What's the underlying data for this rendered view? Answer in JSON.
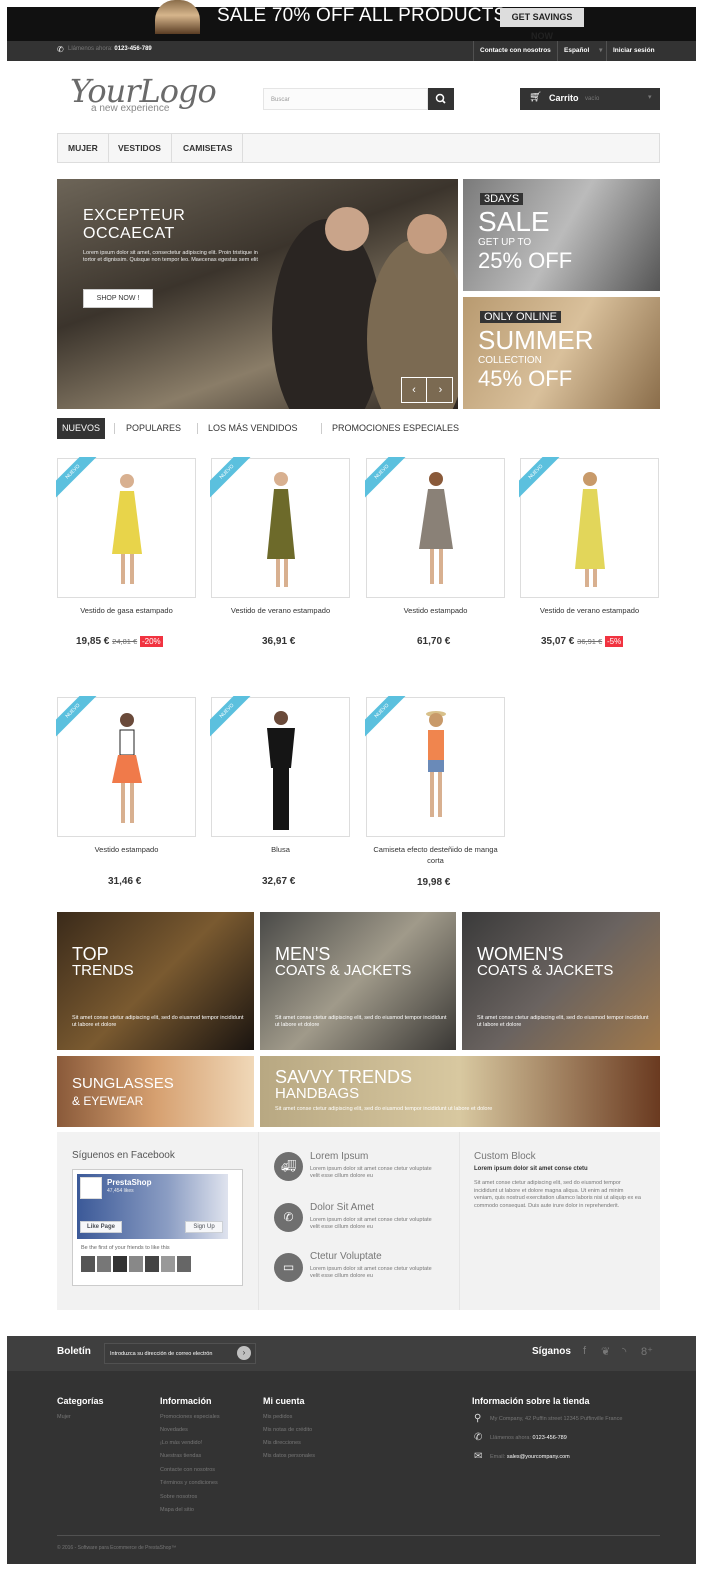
{
  "top_banner": {
    "text": "SALE 70% OFF ALL PRODUCTS",
    "button": "GET SAVINGS NOW"
  },
  "nav": {
    "phone_label": "Llámenos ahora:",
    "phone": "0123-456-789",
    "contact": "Contacte con nosotros",
    "language": "Español",
    "login": "Iniciar sesión"
  },
  "header": {
    "logo": "YourLogo",
    "logo_sub": "a new experience",
    "search_placeholder": "Buscar",
    "cart_label": "Carrito",
    "cart_status": "vacío"
  },
  "menu": [
    "MUJER",
    "VESTIDOS",
    "CAMISETAS"
  ],
  "slider": {
    "title1": "EXCEPTEUR",
    "title2": "OCCAECAT",
    "text": "Lorem ipsum dolor sit amet, consectetur adipiscing elit. Proin tristique in tortor et dignissim. Quisque non tempor leo. Maecenas egestas sem elit",
    "button": "SHOP NOW !"
  },
  "promo1": {
    "tag": "3DAYS",
    "big": "SALE",
    "small": "GET UP TO",
    "value": "25% OFF"
  },
  "promo2": {
    "tag": "ONLY ONLINE",
    "big": "SUMMER",
    "small": "COLLECTION",
    "value": "45% OFF"
  },
  "tabs": [
    "NUEVOS",
    "POPULARES",
    "LOS MÁS VENDIDOS",
    "PROMOCIONES ESPECIALES"
  ],
  "ribbon": "NUEVO",
  "products": [
    {
      "name": "Vestido de gasa estampado",
      "price": "19,85 €",
      "old": "24,81 €",
      "discount": "-20%",
      "dress": "#e8d44a"
    },
    {
      "name": "Vestido de verano estampado",
      "price": "36,91 €",
      "old": "",
      "discount": "",
      "dress": "#6d6a2a"
    },
    {
      "name": "Vestido estampado",
      "price": "61,70 €",
      "old": "",
      "discount": "",
      "dress": "#8a8177"
    },
    {
      "name": "Vestido de verano estampado",
      "price": "35,07 €",
      "old": "36,91 €",
      "discount": "-5%",
      "dress": "#e2d65a"
    },
    {
      "name": "Vestido estampado",
      "price": "31,46 €",
      "old": "",
      "discount": "",
      "dress": "#f07a4a"
    },
    {
      "name": "Blusa",
      "price": "32,67 €",
      "old": "",
      "discount": "",
      "dress": "#151515"
    },
    {
      "name": "Camiseta efecto desteñido de manga corta",
      "price": "19,98 €",
      "old": "",
      "discount": "",
      "dress": "#f0854e"
    }
  ],
  "tiles": {
    "top_trends": {
      "big": "TOP",
      "small": "TRENDS",
      "text": "Sit amet conse ctetur adipiscing elit, sed do eiusmod tempor incididunt ut labore et dolore"
    },
    "mens": {
      "big": "MEN'S",
      "small": "COATS & JACKETS",
      "text": "Sit amet conse ctetur adipiscing elit, sed do eiusmod tempor incididunt ut labore et dolore"
    },
    "womens": {
      "big": "WOMEN'S",
      "small": "COATS & JACKETS",
      "text": "Sit amet conse ctetur adipiscing elit, sed do eiusmod tempor incididunt ut labore et dolore"
    },
    "sunglasses": {
      "big": "SUNGLASSES",
      "small": "& EYEWEAR"
    },
    "savvy": {
      "big": "SAVVY TRENDS",
      "small": "HANDBAGS",
      "text": "Sit amet conse ctetur adipiscing elit, sed do eiusmod tempor incididunt ut labore et dolore"
    }
  },
  "facebook": {
    "title": "Síguenos en Facebook",
    "page_name": "PrestaShop",
    "likes": "47,454 likes",
    "like_button": "Like Page",
    "signup_button": "Sign Up",
    "friends_text": "Be the first of your friends to like this"
  },
  "info_blocks": [
    {
      "title": "Lorem Ipsum",
      "text": "Lorem ipsum dolor sit amet conse ctetur voluptate velit esse cillum dolore eu"
    },
    {
      "title": "Dolor Sit Amet",
      "text": "Lorem ipsum dolor sit amet conse ctetur voluptate velit esse cillum dolore eu"
    },
    {
      "title": "Ctetur Voluptate",
      "text": "Lorem ipsum dolor sit amet conse ctetur voluptate velit esse cillum dolore eu"
    }
  ],
  "custom_block": {
    "title": "Custom Block",
    "subtitle": "Lorem ipsum dolor sit amet conse ctetu",
    "text": "Sit amet conse ctetur adipiscing elit, sed do eiusmod tempor incididunt ut labore et dolore magna aliqua. Ut enim ad minim veniam, quis nostrud exercitation ullamco laboris nisi ut aliquip ex ea commodo consequat. Duis aute irure dolor in reprehenderit."
  },
  "newsletter": {
    "label": "Boletín",
    "placeholder": "Introduzca su dirección de correo electrón"
  },
  "follow": {
    "label": "Síganos"
  },
  "footer": {
    "categories_title": "Categorías",
    "categories": [
      "Mujer"
    ],
    "info_title": "Información",
    "info_links": [
      "Promociones especiales",
      "Novedades",
      "¡Lo más vendido!",
      "Nuestras tiendas",
      "Contacte con nosotros",
      "Términos y condiciones",
      "Sobre nosotros",
      "Mapa del sitio"
    ],
    "account_title": "Mi cuenta",
    "account_links": [
      "Mis pedidos",
      "Mis notas de crédito",
      "Mis direcciones",
      "Mis datos personales"
    ],
    "store_title": "Información sobre la tienda",
    "address": "My Company, 42 Puffin street 12345 Puffinville France",
    "phone_label": "Llámenos ahora:",
    "phone": "0123-456-789",
    "email_label": "Email:",
    "email": "sales@yourcompany.com",
    "copyright": "© 2016 - Software para Ecommerce de PrestaShop™"
  },
  "colors": {
    "dark": "#333333",
    "ribbon": "#5bc0de",
    "discount": "#f13340"
  }
}
